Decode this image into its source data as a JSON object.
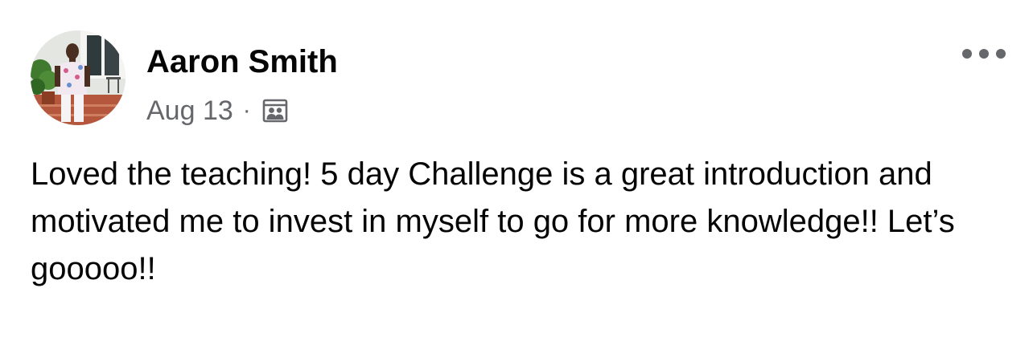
{
  "post": {
    "author": {
      "name": "Aaron Smith",
      "avatar_icon": "profile-photo"
    },
    "date": "Aug 13",
    "separator": "·",
    "audience_icon": "group-members-icon",
    "text": "Loved the teaching! 5 day Challenge is a great introduction and motivated me to invest in myself to go for more knowledge!! Let’s gooooo!!",
    "more_icon": "more-options-icon"
  },
  "colors": {
    "name": "#050505",
    "meta": "#65676b",
    "background": "#ffffff"
  }
}
